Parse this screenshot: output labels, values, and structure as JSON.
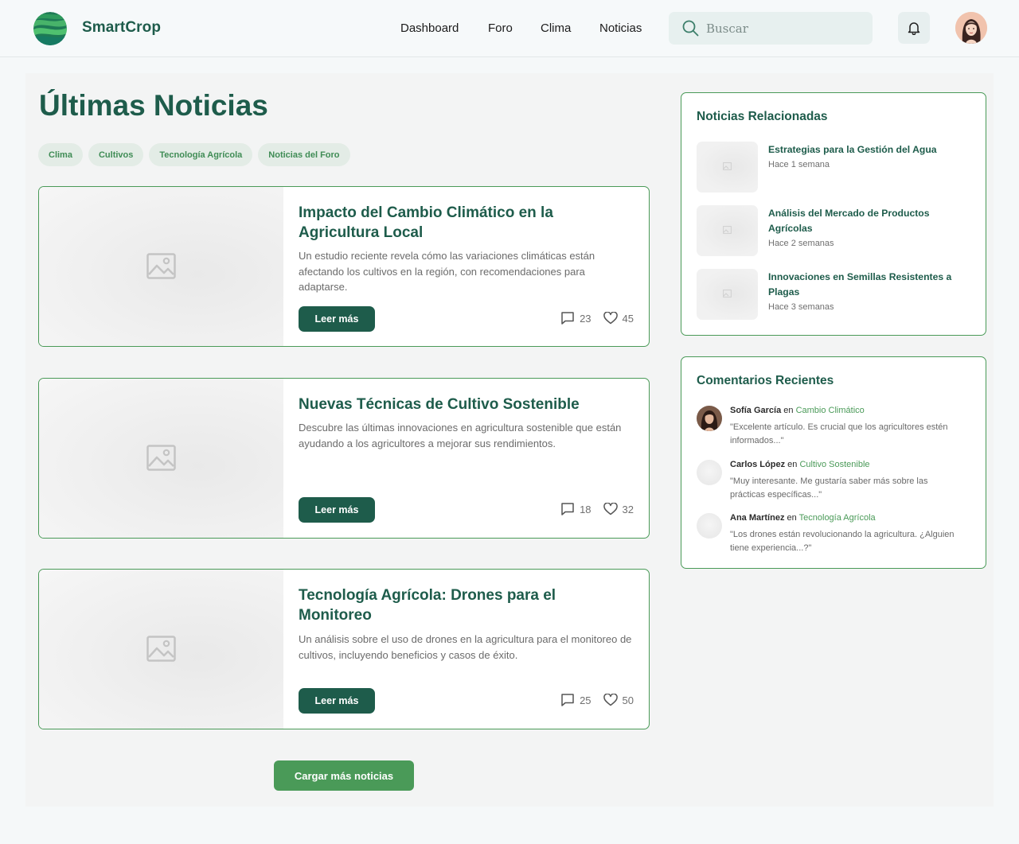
{
  "header": {
    "brand": "SmartCrop",
    "nav": [
      "Dashboard",
      "Foro",
      "Clima",
      "Noticias"
    ],
    "search_placeholder": "Buscar"
  },
  "main": {
    "title": "Últimas Noticias",
    "chips": [
      "Clima",
      "Cultivos",
      "Tecnología Agrícola",
      "Noticias del Foro"
    ],
    "articles": [
      {
        "title": "Impacto del Cambio Climático en la Agricultura Local",
        "desc": "Un estudio reciente revela cómo las variaciones climáticas están afectando los cultivos en la región, con recomendaciones para adaptarse.",
        "button": "Leer más",
        "comments": "23",
        "likes": "45"
      },
      {
        "title": "Nuevas Técnicas de Cultivo Sostenible",
        "desc": "Descubre las últimas innovaciones en agricultura sostenible que están ayudando a los agricultores a mejorar sus rendimientos.",
        "button": "Leer más",
        "comments": "18",
        "likes": "32"
      },
      {
        "title": "Tecnología Agrícola: Drones para el Monitoreo",
        "desc": "Un análisis sobre el uso de drones en la agricultura para el monitoreo de cultivos, incluyendo beneficios y casos de éxito.",
        "button": "Leer más",
        "comments": "25",
        "likes": "50"
      }
    ],
    "load_more": "Cargar más noticias"
  },
  "sidebar": {
    "related": {
      "title": "Noticias Relacionadas",
      "items": [
        {
          "title": "Estrategias para la Gestión del Agua",
          "time": "Hace 1 semana"
        },
        {
          "title": "Análisis del Mercado de Productos Agrícolas",
          "time": "Hace 2 semanas"
        },
        {
          "title": "Innovaciones en Semillas Resistentes a Plagas",
          "time": "Hace 3 semanas"
        }
      ]
    },
    "comments": {
      "title": "Comentarios Recientes",
      "connector": "en",
      "items": [
        {
          "name": "Sofía García",
          "topic": "Cambio Climático",
          "text": "\"Excelente artículo. Es crucial que los agricultores estén informados...\""
        },
        {
          "name": "Carlos López",
          "topic": "Cultivo Sostenible",
          "text": "\"Muy interesante. Me gustaría saber más sobre las prácticas específicas...\""
        },
        {
          "name": "Ana Martínez",
          "topic": "Tecnología Agrícola",
          "text": "\"Los drones están revolucionando la agricultura. ¿Alguien tiene experiencia...?\""
        }
      ]
    }
  },
  "colors": {
    "primary": "#1e5c4b",
    "accent": "#4a9a58",
    "chip_bg": "#e3ece6"
  }
}
